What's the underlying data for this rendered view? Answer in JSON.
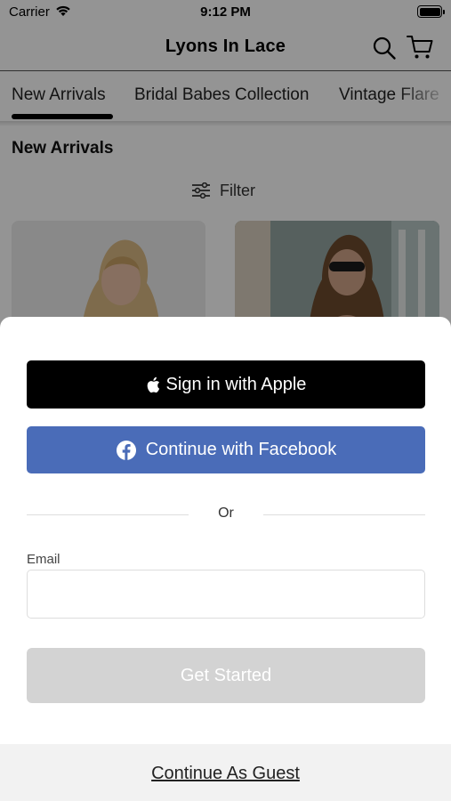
{
  "status_bar": {
    "carrier": "Carrier",
    "time": "9:12 PM",
    "battery_level": 1.0
  },
  "nav": {
    "title": "Lyons In Lace",
    "search_icon": "search-icon",
    "cart_icon": "cart-icon"
  },
  "tabs": [
    {
      "label": "New Arrivals",
      "selected": true
    },
    {
      "label": "Bridal Babes Collection",
      "selected": false
    },
    {
      "label": "Vintage Flare",
      "selected": false
    }
  ],
  "section": {
    "title": "New Arrivals"
  },
  "filter": {
    "label": "Filter",
    "icon": "sliders-icon"
  },
  "products": [
    {
      "image": "model-blonde-white-top"
    },
    {
      "image": "model-sunglasses-black-top"
    }
  ],
  "sheet": {
    "apple_button": {
      "label": "Sign in with Apple",
      "icon": "apple-icon",
      "bg": "#000000"
    },
    "facebook_button": {
      "label": "Continue with Facebook",
      "icon": "facebook-icon",
      "bg": "#4a6cb8"
    },
    "divider": {
      "label": "Or"
    },
    "email": {
      "label": "Email",
      "value": "",
      "placeholder": ""
    },
    "get_started": {
      "label": "Get Started",
      "enabled": false
    },
    "guest": {
      "label": "Continue As Guest"
    }
  }
}
